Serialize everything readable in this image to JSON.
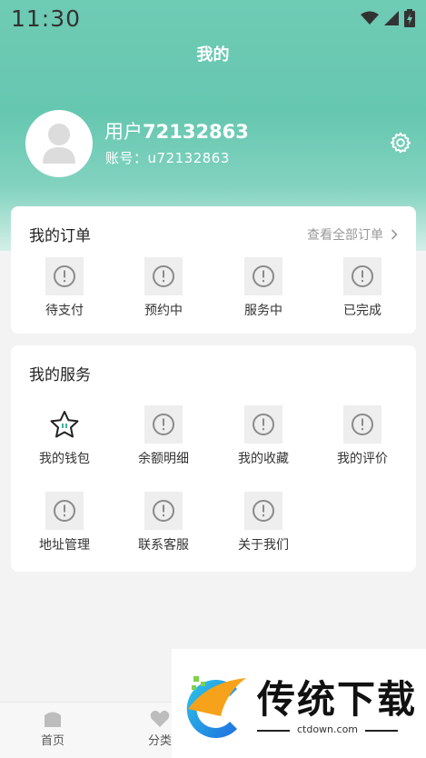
{
  "status_bar": {
    "time": "11:30"
  },
  "header": {
    "title": "我的"
  },
  "profile": {
    "name_prefix": "用户",
    "name_number": "72132863",
    "account_label": "账号：",
    "account_value": "u72132863"
  },
  "orders": {
    "title": "我的订单",
    "view_all": "查看全部订单",
    "items": [
      {
        "label": "待支付",
        "icon": "alert-circle-icon"
      },
      {
        "label": "预约中",
        "icon": "alert-circle-icon"
      },
      {
        "label": "服务中",
        "icon": "alert-circle-icon"
      },
      {
        "label": "已完成",
        "icon": "alert-circle-icon"
      }
    ]
  },
  "services": {
    "title": "我的服务",
    "items": [
      {
        "label": "我的钱包",
        "icon": "star-icon"
      },
      {
        "label": "余额明细",
        "icon": "alert-circle-icon"
      },
      {
        "label": "我的收藏",
        "icon": "alert-circle-icon"
      },
      {
        "label": "我的评价",
        "icon": "alert-circle-icon"
      },
      {
        "label": "地址管理",
        "icon": "alert-circle-icon"
      },
      {
        "label": "联系客服",
        "icon": "alert-circle-icon"
      },
      {
        "label": "关于我们",
        "icon": "alert-circle-icon"
      }
    ]
  },
  "tabbar": {
    "items": [
      {
        "label": "首页",
        "icon": "home-icon"
      },
      {
        "label": "分类",
        "icon": "heart-icon"
      }
    ]
  },
  "watermark": {
    "title": "传统下载",
    "domain": "ctdown.com"
  },
  "colors": {
    "header_gradient_top": "#6fcbb4",
    "accent": "#3fb59a",
    "icon_gray": "#8a8a8a"
  }
}
